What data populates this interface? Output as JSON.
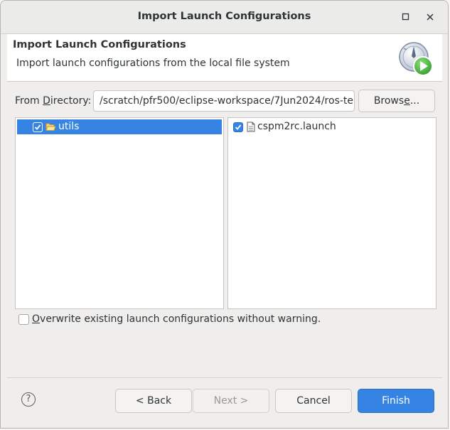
{
  "window": {
    "title": "Import Launch Configurations"
  },
  "banner": {
    "title": "Import Launch Configurations",
    "description": "Import launch configurations from the local file system",
    "icon": "launch-wizard-icon"
  },
  "directory": {
    "label_pre": "From ",
    "label_mnemonic": "D",
    "label_post": "irectory:",
    "value": "/scratch/pfr500/eclipse-workspace/7Jun2024/ros-te",
    "browse_pre": "Brows",
    "browse_mnemonic": "e",
    "browse_post": "..."
  },
  "left_tree": {
    "items": [
      {
        "label": "utils",
        "checked": true,
        "selected": true,
        "icon": "folder-open-icon"
      }
    ]
  },
  "right_list": {
    "items": [
      {
        "label": "cspm2rc.launch",
        "checked": true,
        "icon": "file-icon"
      }
    ]
  },
  "overwrite": {
    "mnemonic": "O",
    "label_rest": "verwrite existing launch configurations without warning.",
    "checked": false
  },
  "buttons": {
    "help": "?",
    "back": "< Back",
    "next": "Next >",
    "cancel": "Cancel",
    "finish": "Finish"
  },
  "colors": {
    "accent": "#3584e4",
    "window_bg": "#efeeed",
    "disabled_text": "#9a9996"
  }
}
